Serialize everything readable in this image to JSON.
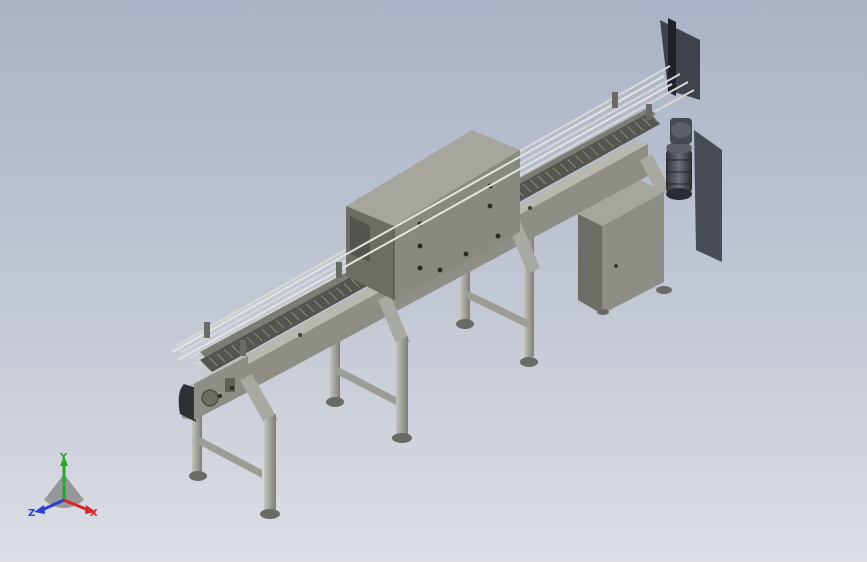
{
  "viewport": {
    "background_top": "#a9b2c6",
    "background_bottom": "#dcdee4"
  },
  "model": {
    "subject": "conveyor",
    "colors": {
      "steel": "#8e8e86",
      "steel_light": "#b8b8b0",
      "steel_dark": "#5f5f58",
      "cabinet_front": "#898980",
      "cabinet_side": "#6d6d66",
      "cabinet_top": "#a6a69e",
      "motor": "#3e4248",
      "shadow": "#2b2e36",
      "rail": "#d4d4d0",
      "chain": "#55554f"
    }
  },
  "triad": {
    "x_label": "X",
    "y_label": "Y",
    "z_label": "Z",
    "x_color": "#d8262a",
    "y_color": "#27a52d",
    "z_color": "#2a3fd1"
  }
}
